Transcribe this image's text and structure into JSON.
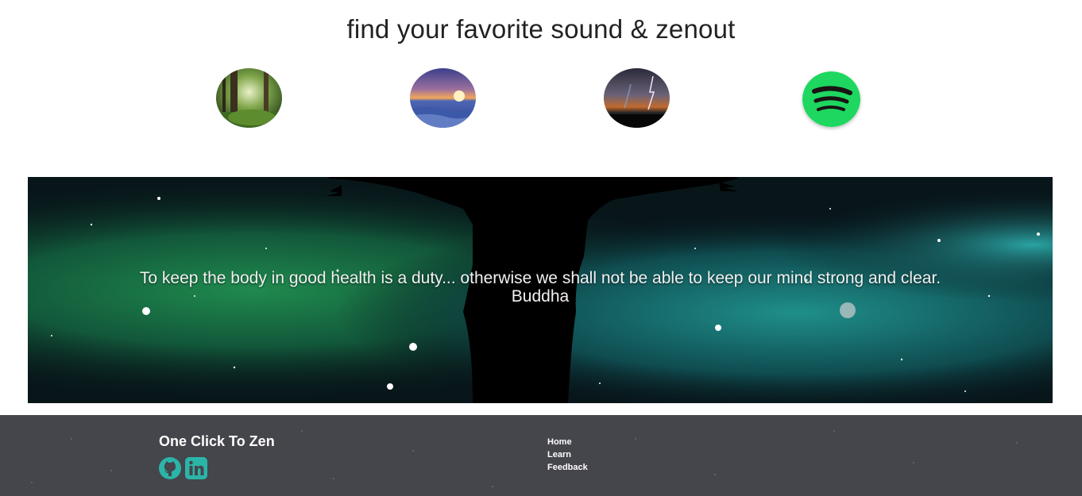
{
  "header": {
    "title": "find your favorite sound & zenout"
  },
  "sounds": [
    {
      "name": "forest",
      "icon": "forest-icon"
    },
    {
      "name": "ocean-sunset",
      "icon": "ocean-sunset-icon"
    },
    {
      "name": "thunderstorm",
      "icon": "lightning-storm-icon"
    },
    {
      "name": "spotify",
      "icon": "spotify-icon",
      "color": "#1ed760"
    }
  ],
  "hero": {
    "quote": "To keep the body in good health is a duty... otherwise we shall not be able to keep our mind strong and clear. Buddha"
  },
  "footer": {
    "title": "One Click To Zen",
    "social": [
      {
        "name": "github",
        "icon": "github-icon",
        "color": "#2bb5a8"
      },
      {
        "name": "linkedin",
        "icon": "linkedin-icon",
        "color": "#2bb5a8"
      }
    ],
    "links": [
      "Home",
      "Learn",
      "Feedback"
    ],
    "background": "#45454c"
  }
}
